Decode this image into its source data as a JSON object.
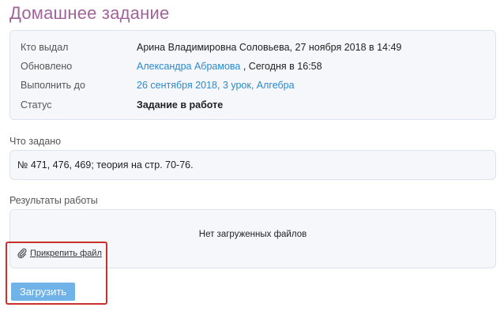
{
  "page_title": "Домашнее задание",
  "info": {
    "rows": [
      {
        "label": "Кто выдал",
        "value": "Арина Владимировна Соловьева, 27 ноября 2018 в 14:49"
      },
      {
        "label": "Обновлено",
        "value_link": "Александра Абрамова",
        "value_rest": " , Сегодня в 16:58"
      },
      {
        "label": "Выполнить до",
        "value_link": "26 сентября 2018, 3 урок, Алгебра"
      },
      {
        "label": "Статус",
        "value": "Задание в работе"
      }
    ]
  },
  "task": {
    "label": "Что задано",
    "text": "№ 471, 476, 469; теория на стр. 70-76."
  },
  "results": {
    "label": "Результаты работы",
    "empty_text": "Нет загруженных файлов",
    "attach_label": "Прикрепить файл",
    "attach_icon": "paperclip-icon"
  },
  "upload_button": "Загрузить",
  "colors": {
    "title": "#a0649a",
    "link": "#2b8ad1",
    "button": "#6fb3e8",
    "highlight": "#c8302c",
    "panel_bg": "#f5f7fb"
  }
}
